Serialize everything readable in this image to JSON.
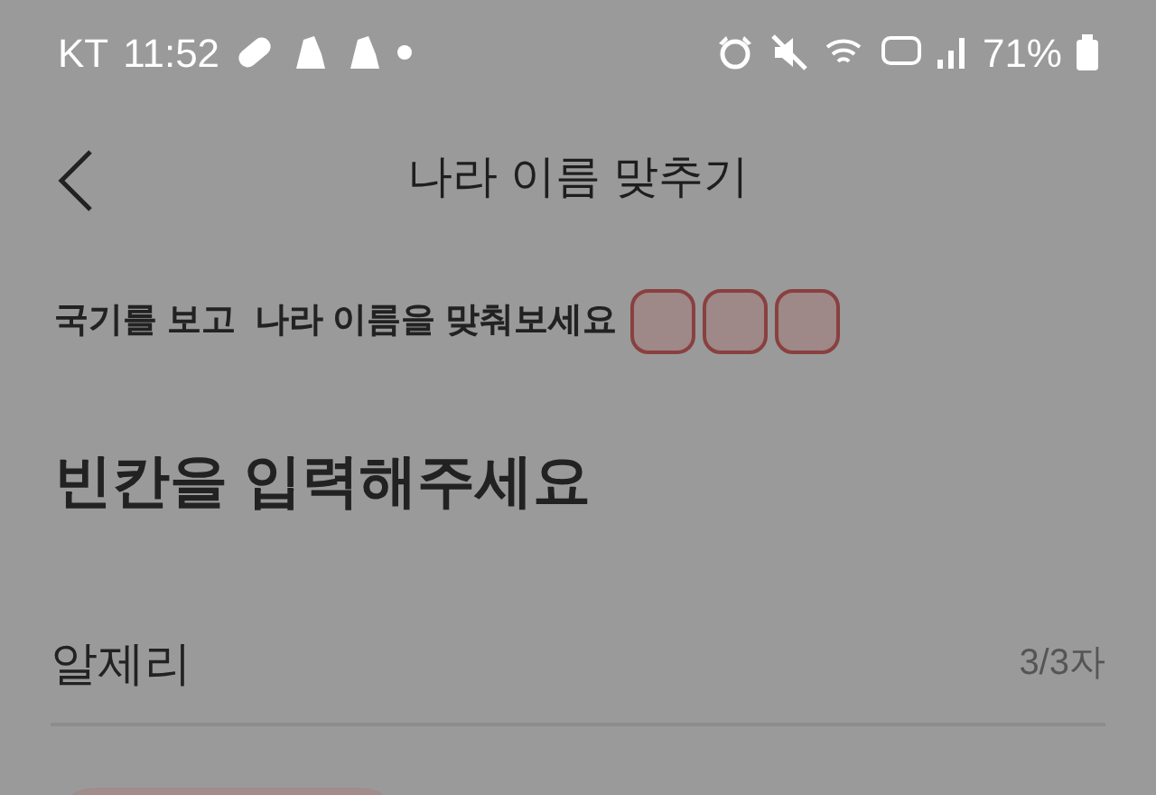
{
  "status_bar": {
    "carrier": "KT",
    "time": "11:52",
    "battery": "71%"
  },
  "header": {
    "title": "나라 이름 맞추기"
  },
  "instruction": "국기를 보고  나라 이름을 맞춰보세요",
  "heading": "빈칸을 입력해주세요",
  "answer": {
    "value": "알제리",
    "counter": "3/3자"
  }
}
